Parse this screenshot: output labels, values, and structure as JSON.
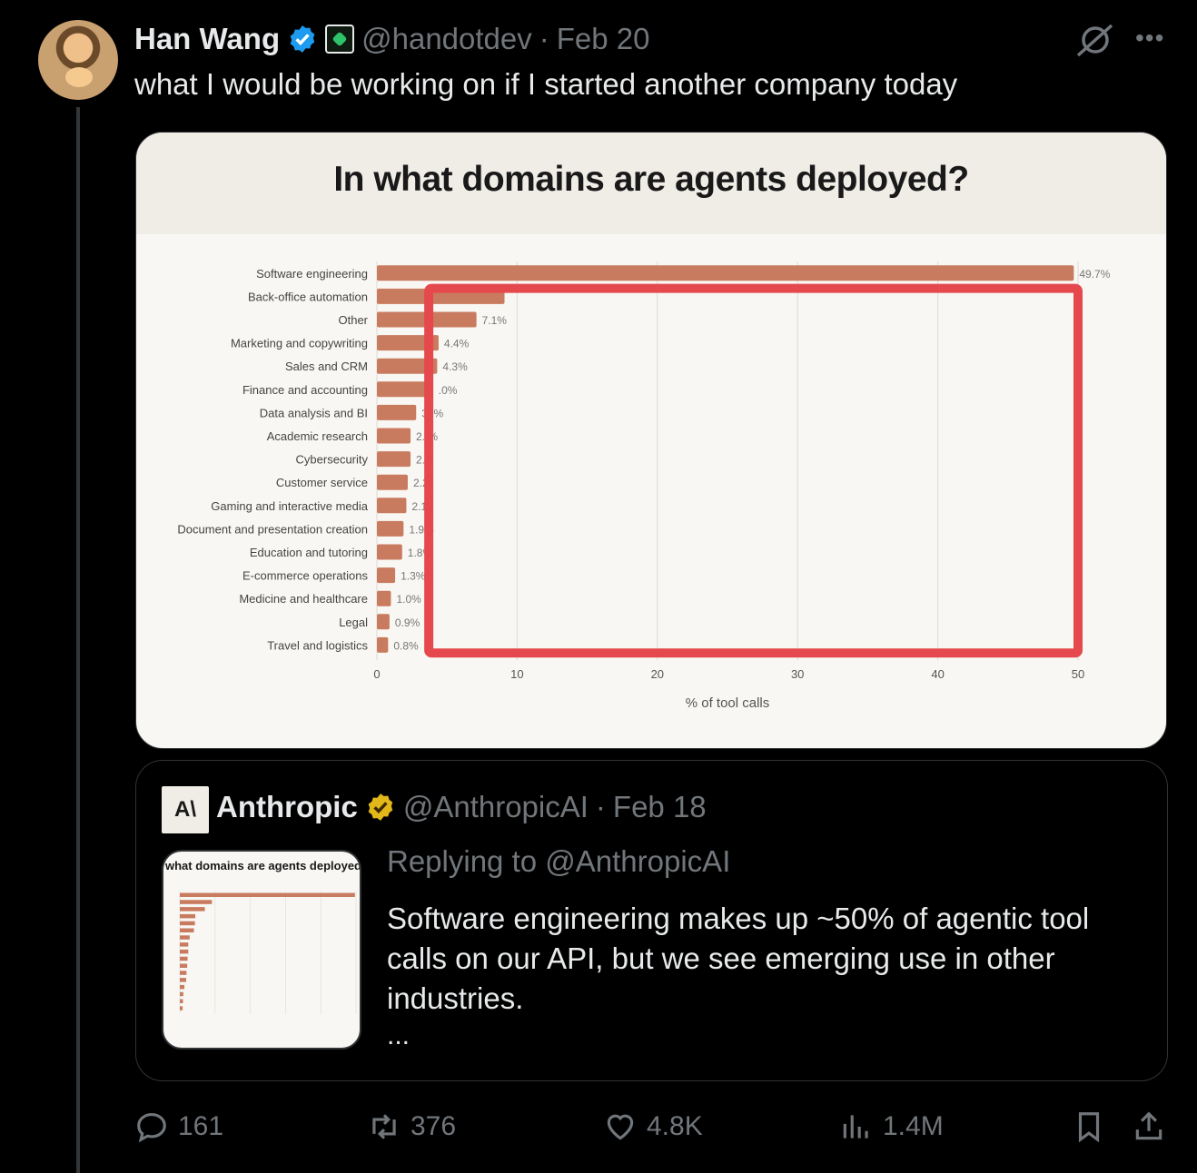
{
  "tweet": {
    "author_name": "Han Wang",
    "handle": "@handotdev",
    "separator": "·",
    "date": "Feb 20",
    "text": "what I would be working on if I started another company today",
    "more_icon": "more-icon"
  },
  "media_chart": {
    "title": "In what domains are agents deployed?"
  },
  "chart_data": {
    "type": "bar",
    "orientation": "horizontal",
    "title": "In what domains are agents deployed?",
    "xlabel": "% of tool calls",
    "ylabel": "",
    "xlim": [
      0,
      50
    ],
    "x_ticks": [
      "0",
      "10",
      "20",
      "30",
      "40",
      "50"
    ],
    "bar_color": "#c97b5f",
    "categories": [
      "Software engineering",
      "Back-office automation",
      "Other",
      "Marketing and copywriting",
      "Sales and CRM",
      "Finance and accounting",
      "Data analysis and BI",
      "Academic research",
      "Cybersecurity",
      "Customer service",
      "Gaming and interactive media",
      "Document and presentation creation",
      "Education and tutoring",
      "E-commerce operations",
      "Medicine and healthcare",
      "Legal",
      "Travel and logistics"
    ],
    "values": [
      49.7,
      9.1,
      7.1,
      4.4,
      4.3,
      4.0,
      2.8,
      2.4,
      2.4,
      2.2,
      2.1,
      1.9,
      1.8,
      1.3,
      1.0,
      0.9,
      0.8
    ],
    "data_labels": [
      "49.7%",
      "",
      "7.1%",
      "4.4%",
      "4.3%",
      ".0%",
      "3.  %",
      "2.  %",
      "2.4",
      "2.2",
      "2.1",
      "1.9%",
      "1.8%",
      "1.3%",
      "1.0%",
      "0.9%",
      "0.8%"
    ],
    "annotation": {
      "type": "red-rectangle",
      "x_range": [
        3.7,
        50
      ],
      "category_range": [
        "Back-office automation",
        "Travel and logistics"
      ],
      "color": "#e5484d"
    },
    "grid": true
  },
  "quote": {
    "logo_text": "A\\",
    "author_name": "Anthropic",
    "handle": "@AnthropicAI",
    "separator": "·",
    "date": "Feb 18",
    "replying_to": "Replying to @AnthropicAI",
    "text": "Software engineering makes up ~50% of agentic tool calls on our API, but we see emerging use in other industries.",
    "ellipsis": "...",
    "thumb_title": "what domains are agents deployed"
  },
  "actions": {
    "replies": "161",
    "reposts": "376",
    "likes": "4.8K",
    "views": "1.4M"
  },
  "colors": {
    "background": "#000000",
    "muted": "#71767b",
    "text": "#e7e9ea",
    "verified_blue": "#1d9bf0",
    "verified_gold": "#e2b719"
  }
}
